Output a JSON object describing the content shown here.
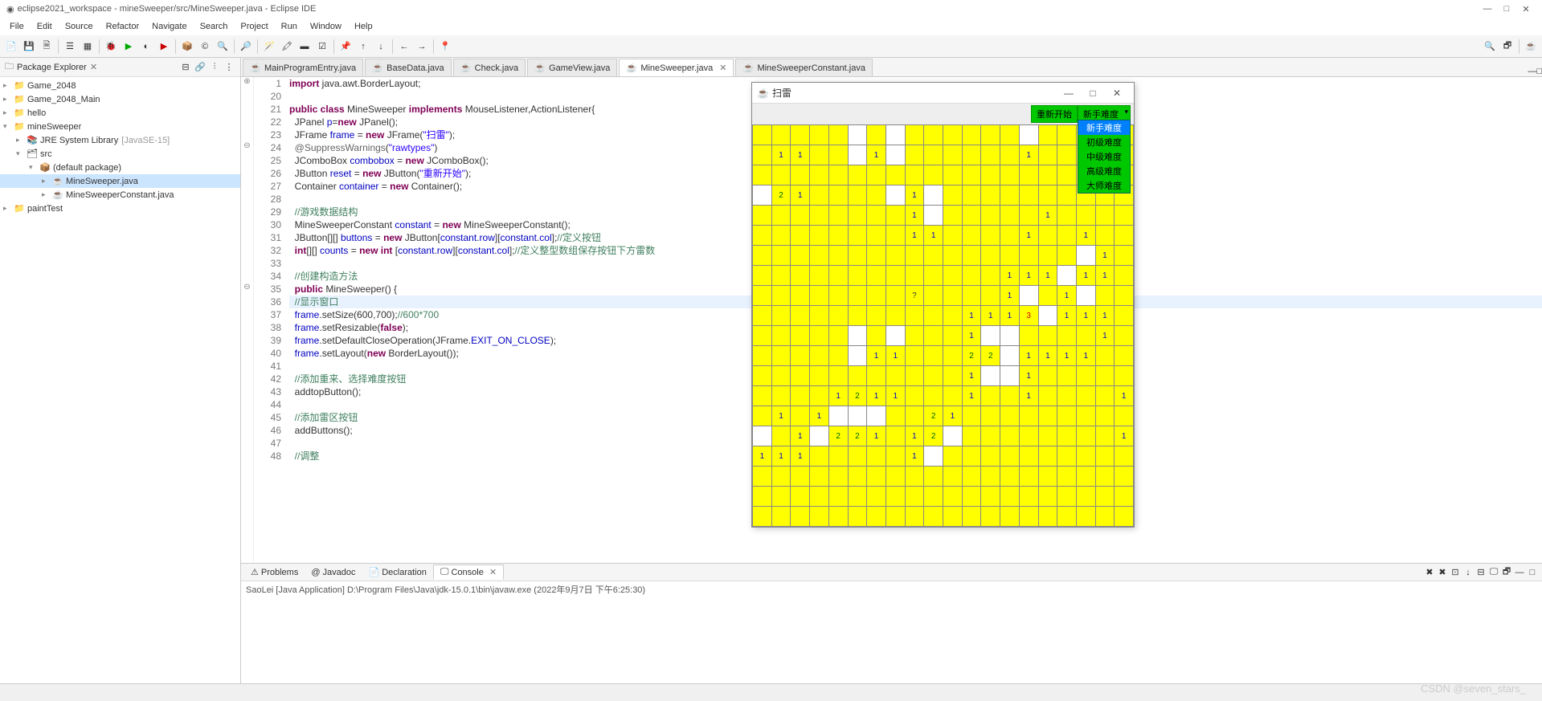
{
  "window": {
    "title": "eclipse2021_workspace - mineSweeper/src/MineSweeper.java - Eclipse IDE",
    "min": "—",
    "max": "□",
    "close": "✕"
  },
  "menu": [
    "File",
    "Edit",
    "Source",
    "Refactor",
    "Navigate",
    "Search",
    "Project",
    "Run",
    "Window",
    "Help"
  ],
  "package_explorer": {
    "title": "Package Explorer",
    "items": [
      {
        "indent": 0,
        "arrow": "▸",
        "icon": "project",
        "label": "Game_2048"
      },
      {
        "indent": 0,
        "arrow": "▸",
        "icon": "project",
        "label": "Game_2048_Main"
      },
      {
        "indent": 0,
        "arrow": "▸",
        "icon": "project",
        "label": "hello"
      },
      {
        "indent": 0,
        "arrow": "▾",
        "icon": "project",
        "label": "mineSweeper"
      },
      {
        "indent": 1,
        "arrow": "▸",
        "icon": "lib",
        "label": "JRE System Library",
        "deco": "[JavaSE-15]"
      },
      {
        "indent": 1,
        "arrow": "▾",
        "icon": "src",
        "label": "src"
      },
      {
        "indent": 2,
        "arrow": "▾",
        "icon": "pkg",
        "label": "(default package)"
      },
      {
        "indent": 3,
        "arrow": "▸",
        "icon": "java",
        "label": "MineSweeper.java",
        "selected": true
      },
      {
        "indent": 3,
        "arrow": "▸",
        "icon": "java",
        "label": "MineSweeperConstant.java"
      },
      {
        "indent": 0,
        "arrow": "▸",
        "icon": "project",
        "label": "paintTest"
      }
    ]
  },
  "editor_tabs": [
    {
      "label": "MainProgramEntry.java"
    },
    {
      "label": "BaseData.java"
    },
    {
      "label": "Check.java"
    },
    {
      "label": "GameView.java"
    },
    {
      "label": "MineSweeper.java",
      "active": true,
      "closable": true
    },
    {
      "label": "MineSweeperConstant.java"
    }
  ],
  "code": {
    "start_line": 1,
    "lines": [
      {
        "n": "1",
        "marker": "⊕",
        "tokens": [
          {
            "t": "kw",
            "s": "import"
          },
          {
            "t": "",
            "s": " java.awt.BorderLayout;"
          }
        ]
      },
      {
        "n": "20",
        "tokens": []
      },
      {
        "n": "21",
        "tokens": [
          {
            "t": "kw",
            "s": "public class"
          },
          {
            "t": "",
            "s": " MineSweeper "
          },
          {
            "t": "kw",
            "s": "implements"
          },
          {
            "t": "",
            "s": " MouseListener,ActionListener{"
          }
        ]
      },
      {
        "n": "22",
        "tokens": [
          {
            "t": "",
            "s": "  JPanel "
          },
          {
            "t": "fld",
            "s": "p"
          },
          {
            "t": "",
            "s": "="
          },
          {
            "t": "kw",
            "s": "new"
          },
          {
            "t": "",
            "s": " JPanel();"
          }
        ]
      },
      {
        "n": "23",
        "tokens": [
          {
            "t": "",
            "s": "  JFrame "
          },
          {
            "t": "fld",
            "s": "frame"
          },
          {
            "t": "",
            "s": " = "
          },
          {
            "t": "kw",
            "s": "new"
          },
          {
            "t": "",
            "s": " JFrame("
          },
          {
            "t": "str",
            "s": "\"扫雷\""
          },
          {
            "t": "",
            "s": ");"
          }
        ]
      },
      {
        "n": "24",
        "marker": "⊖",
        "tokens": [
          {
            "t": "",
            "s": "  "
          },
          {
            "t": "ann",
            "s": "@SuppressWarnings"
          },
          {
            "t": "",
            "s": "("
          },
          {
            "t": "str",
            "s": "\"rawtypes\""
          },
          {
            "t": "",
            "s": ")"
          }
        ]
      },
      {
        "n": "25",
        "tokens": [
          {
            "t": "",
            "s": "  JComboBox "
          },
          {
            "t": "fld",
            "s": "combobox"
          },
          {
            "t": "",
            "s": " = "
          },
          {
            "t": "kw",
            "s": "new"
          },
          {
            "t": "",
            "s": " JComboBox();"
          }
        ]
      },
      {
        "n": "26",
        "tokens": [
          {
            "t": "",
            "s": "  JButton "
          },
          {
            "t": "fld",
            "s": "reset"
          },
          {
            "t": "",
            "s": " = "
          },
          {
            "t": "kw",
            "s": "new"
          },
          {
            "t": "",
            "s": " JButton("
          },
          {
            "t": "str",
            "s": "\"重新开始\""
          },
          {
            "t": "",
            "s": ");"
          }
        ]
      },
      {
        "n": "27",
        "tokens": [
          {
            "t": "",
            "s": "  Container "
          },
          {
            "t": "fld",
            "s": "container"
          },
          {
            "t": "",
            "s": " = "
          },
          {
            "t": "kw",
            "s": "new"
          },
          {
            "t": "",
            "s": " Container();"
          }
        ]
      },
      {
        "n": "28",
        "tokens": []
      },
      {
        "n": "29",
        "tokens": [
          {
            "t": "",
            "s": "  "
          },
          {
            "t": "cmt",
            "s": "//游戏数据结构"
          }
        ]
      },
      {
        "n": "30",
        "tokens": [
          {
            "t": "",
            "s": "  MineSweeperConstant "
          },
          {
            "t": "fld",
            "s": "constant"
          },
          {
            "t": "",
            "s": " = "
          },
          {
            "t": "kw",
            "s": "new"
          },
          {
            "t": "",
            "s": " MineSweeperConstant();"
          }
        ]
      },
      {
        "n": "31",
        "tokens": [
          {
            "t": "",
            "s": "  JButton[][] "
          },
          {
            "t": "fld",
            "s": "buttons"
          },
          {
            "t": "",
            "s": " = "
          },
          {
            "t": "kw",
            "s": "new"
          },
          {
            "t": "",
            "s": " JButton["
          },
          {
            "t": "fld",
            "s": "constant"
          },
          {
            "t": "",
            "s": "."
          },
          {
            "t": "fld",
            "s": "row"
          },
          {
            "t": "",
            "s": "]["
          },
          {
            "t": "fld",
            "s": "constant"
          },
          {
            "t": "",
            "s": "."
          },
          {
            "t": "fld",
            "s": "col"
          },
          {
            "t": "",
            "s": "];"
          },
          {
            "t": "cmt",
            "s": "//定义按钮"
          }
        ]
      },
      {
        "n": "32",
        "tokens": [
          {
            "t": "",
            "s": "  "
          },
          {
            "t": "kw",
            "s": "int"
          },
          {
            "t": "",
            "s": "[][] "
          },
          {
            "t": "fld",
            "s": "counts"
          },
          {
            "t": "",
            "s": " = "
          },
          {
            "t": "kw",
            "s": "new int"
          },
          {
            "t": "",
            "s": " ["
          },
          {
            "t": "fld",
            "s": "constant"
          },
          {
            "t": "",
            "s": "."
          },
          {
            "t": "fld",
            "s": "row"
          },
          {
            "t": "",
            "s": "]["
          },
          {
            "t": "fld",
            "s": "constant"
          },
          {
            "t": "",
            "s": "."
          },
          {
            "t": "fld",
            "s": "col"
          },
          {
            "t": "",
            "s": "];"
          },
          {
            "t": "cmt",
            "s": "//定义整型数组保存按钮下方雷数"
          }
        ]
      },
      {
        "n": "33",
        "tokens": []
      },
      {
        "n": "34",
        "tokens": [
          {
            "t": "",
            "s": "  "
          },
          {
            "t": "cmt",
            "s": "//创建构造方法"
          }
        ]
      },
      {
        "n": "35",
        "marker": "⊖",
        "tokens": [
          {
            "t": "",
            "s": "  "
          },
          {
            "t": "kw",
            "s": "public"
          },
          {
            "t": "",
            "s": " MineSweeper() {"
          }
        ]
      },
      {
        "n": "36",
        "highlight": true,
        "tokens": [
          {
            "t": "",
            "s": "  "
          },
          {
            "t": "cmt",
            "s": "//显示窗口"
          }
        ]
      },
      {
        "n": "37",
        "tokens": [
          {
            "t": "",
            "s": "  "
          },
          {
            "t": "fld",
            "s": "frame"
          },
          {
            "t": "",
            "s": ".setSize(600,700);"
          },
          {
            "t": "cmt",
            "s": "//600*700"
          }
        ]
      },
      {
        "n": "38",
        "tokens": [
          {
            "t": "",
            "s": "  "
          },
          {
            "t": "fld",
            "s": "frame"
          },
          {
            "t": "",
            "s": ".setResizable("
          },
          {
            "t": "kw",
            "s": "false"
          },
          {
            "t": "",
            "s": ");"
          }
        ]
      },
      {
        "n": "39",
        "tokens": [
          {
            "t": "",
            "s": "  "
          },
          {
            "t": "fld",
            "s": "frame"
          },
          {
            "t": "",
            "s": ".setDefaultCloseOperation(JFrame."
          },
          {
            "t": "fld",
            "s": "EXIT_ON_CLOSE"
          },
          {
            "t": "",
            "s": ");"
          }
        ]
      },
      {
        "n": "40",
        "tokens": [
          {
            "t": "",
            "s": "  "
          },
          {
            "t": "fld",
            "s": "frame"
          },
          {
            "t": "",
            "s": ".setLayout("
          },
          {
            "t": "kw",
            "s": "new"
          },
          {
            "t": "",
            "s": " BorderLayout());"
          }
        ]
      },
      {
        "n": "41",
        "tokens": []
      },
      {
        "n": "42",
        "tokens": [
          {
            "t": "",
            "s": "  "
          },
          {
            "t": "cmt",
            "s": "//添加重来、选择难度按钮"
          }
        ]
      },
      {
        "n": "43",
        "tokens": [
          {
            "t": "",
            "s": "  addtopButton();"
          }
        ]
      },
      {
        "n": "44",
        "tokens": []
      },
      {
        "n": "45",
        "tokens": [
          {
            "t": "",
            "s": "  "
          },
          {
            "t": "cmt",
            "s": "//添加雷区按钮"
          }
        ]
      },
      {
        "n": "46",
        "tokens": [
          {
            "t": "",
            "s": "  addButtons();"
          }
        ]
      },
      {
        "n": "47",
        "tokens": []
      },
      {
        "n": "48",
        "tokens": [
          {
            "t": "",
            "s": "  "
          },
          {
            "t": "cmt",
            "s": "//调整"
          }
        ]
      }
    ]
  },
  "bottom": {
    "tabs": [
      {
        "label": "Problems",
        "icon": "warn"
      },
      {
        "label": "Javadoc",
        "icon": "at"
      },
      {
        "label": "Declaration",
        "icon": "decl"
      },
      {
        "label": "Console",
        "icon": "console",
        "active": true,
        "closable": true
      }
    ],
    "console_line": "SaoLei [Java Application] D:\\Program Files\\Java\\jdk-15.0.1\\bin\\javaw.exe  (2022年9月7日 下午6:25:30)"
  },
  "game": {
    "title": "扫雷",
    "reset": "重新开始",
    "difficulty": "新手难度",
    "difficulty_options": [
      "新手难度",
      "初级难度",
      "中级难度",
      "高级难度",
      "大师难度"
    ],
    "cols": 20,
    "rows": 20,
    "grid": [
      [
        0,
        0,
        0,
        0,
        0,
        -1,
        0,
        -1,
        0,
        0,
        0,
        0,
        0,
        0,
        -1,
        0,
        0,
        0,
        0,
        0
      ],
      [
        0,
        1,
        1,
        0,
        0,
        -1,
        1,
        -1,
        0,
        0,
        0,
        0,
        0,
        0,
        1,
        0,
        0,
        0,
        0,
        0
      ],
      [
        0,
        0,
        0,
        0,
        0,
        0,
        0,
        0,
        0,
        0,
        0,
        0,
        0,
        0,
        0,
        0,
        0,
        0,
        0,
        0
      ],
      [
        -1,
        2,
        1,
        0,
        0,
        0,
        0,
        -1,
        1,
        -1,
        0,
        0,
        0,
        0,
        0,
        0,
        0,
        0,
        0,
        0
      ],
      [
        0,
        0,
        0,
        0,
        0,
        0,
        0,
        0,
        1,
        -1,
        0,
        0,
        0,
        0,
        0,
        1,
        0,
        0,
        0,
        0
      ],
      [
        0,
        0,
        0,
        0,
        0,
        0,
        0,
        0,
        1,
        1,
        0,
        0,
        0,
        0,
        1,
        0,
        0,
        1,
        0,
        0
      ],
      [
        0,
        0,
        0,
        0,
        0,
        0,
        0,
        0,
        0,
        0,
        0,
        0,
        0,
        0,
        0,
        0,
        0,
        -1,
        1,
        0
      ],
      [
        0,
        0,
        0,
        0,
        0,
        0,
        0,
        0,
        0,
        0,
        0,
        0,
        0,
        1,
        1,
        1,
        -1,
        1,
        1,
        0
      ],
      [
        0,
        0,
        0,
        0,
        0,
        0,
        0,
        0,
        -2,
        0,
        0,
        0,
        0,
        1,
        -1,
        0,
        1,
        -1,
        0,
        0
      ],
      [
        0,
        0,
        0,
        0,
        0,
        0,
        0,
        0,
        0,
        0,
        0,
        1,
        1,
        1,
        3,
        -1,
        1,
        1,
        1,
        0
      ],
      [
        0,
        0,
        0,
        0,
        0,
        -1,
        0,
        -1,
        0,
        0,
        0,
        1,
        -1,
        -1,
        0,
        0,
        0,
        0,
        1,
        0
      ],
      [
        0,
        0,
        0,
        0,
        0,
        -1,
        1,
        1,
        0,
        0,
        0,
        2,
        2,
        -1,
        1,
        1,
        1,
        1,
        0,
        0
      ],
      [
        0,
        0,
        0,
        0,
        0,
        0,
        0,
        0,
        0,
        0,
        0,
        1,
        -1,
        -1,
        1,
        0,
        0,
        0,
        0,
        0
      ],
      [
        0,
        0,
        0,
        0,
        1,
        2,
        1,
        1,
        0,
        0,
        0,
        1,
        0,
        0,
        1,
        0,
        0,
        0,
        0,
        1
      ],
      [
        0,
        1,
        0,
        1,
        -1,
        -1,
        -1,
        0,
        0,
        2,
        1,
        0,
        0,
        0,
        0,
        0,
        0,
        0,
        0,
        0
      ],
      [
        -1,
        0,
        1,
        -1,
        2,
        2,
        1,
        0,
        1,
        2,
        -1,
        0,
        0,
        0,
        0,
        0,
        0,
        0,
        0,
        1
      ],
      [
        1,
        1,
        1,
        0,
        0,
        0,
        0,
        0,
        1,
        -1,
        0,
        0,
        0,
        0,
        0,
        0,
        0,
        0,
        0,
        0
      ],
      [
        0,
        0,
        0,
        0,
        0,
        0,
        0,
        0,
        0,
        0,
        0,
        0,
        0,
        0,
        0,
        0,
        0,
        0,
        0,
        0
      ],
      [
        0,
        0,
        0,
        0,
        0,
        0,
        0,
        0,
        0,
        0,
        0,
        0,
        0,
        0,
        0,
        0,
        0,
        0,
        0,
        0
      ],
      [
        0,
        0,
        0,
        0,
        0,
        0,
        0,
        0,
        0,
        0,
        0,
        0,
        0,
        0,
        0,
        0,
        0,
        0,
        0,
        0
      ]
    ]
  },
  "watermark": "CSDN @seven_stars_"
}
